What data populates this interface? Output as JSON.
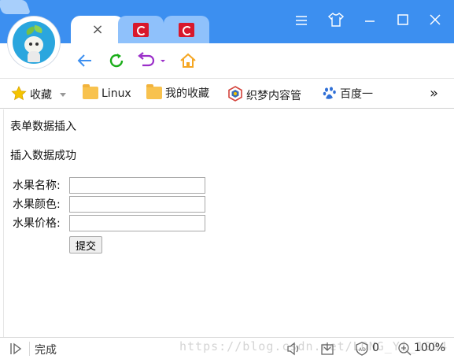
{
  "colors": {
    "titlebar": "#3c8ff0",
    "tab_inactive": "#8fc1fb",
    "accent_green": "#1aad19",
    "accent_purple": "#9b2fc9",
    "home": "#f5a623"
  },
  "tabs": {
    "active": {
      "close_icon": "close-icon"
    },
    "inactive": [
      {
        "icon": "c-app-icon"
      },
      {
        "icon": "c-app-icon"
      }
    ],
    "new_tab": {
      "icon": "new-tab-icon"
    }
  },
  "window_controls": [
    "menu-icon",
    "skin-icon",
    "minimize-icon",
    "maximize-icon",
    "close-window-icon"
  ],
  "nav": [
    "back-icon",
    "refresh-icon",
    "undo-icon",
    "home-icon"
  ],
  "bookmarks": {
    "favorites_label": "收藏",
    "items": [
      {
        "label": "Linux",
        "icon": "folder-icon"
      },
      {
        "label": "我的收藏",
        "icon": "folder-icon"
      },
      {
        "label": "织梦内容管",
        "icon": "dedecms-icon"
      },
      {
        "label": "百度一",
        "icon": "baidu-paw-icon"
      }
    ],
    "overflow": "»"
  },
  "page": {
    "heading": "表单数据插入",
    "message": "插入数据成功",
    "form": {
      "fields": [
        {
          "label": "水果名称:",
          "value": ""
        },
        {
          "label": "水果颜色:",
          "value": ""
        },
        {
          "label": "水果价格:",
          "value": ""
        }
      ],
      "submit_label": "提交"
    }
  },
  "status": {
    "text": "完成",
    "watermark": "https://blog.csdn.net/LONG_Yi_1994",
    "ad_block_count": "0",
    "zoom": "100%"
  }
}
